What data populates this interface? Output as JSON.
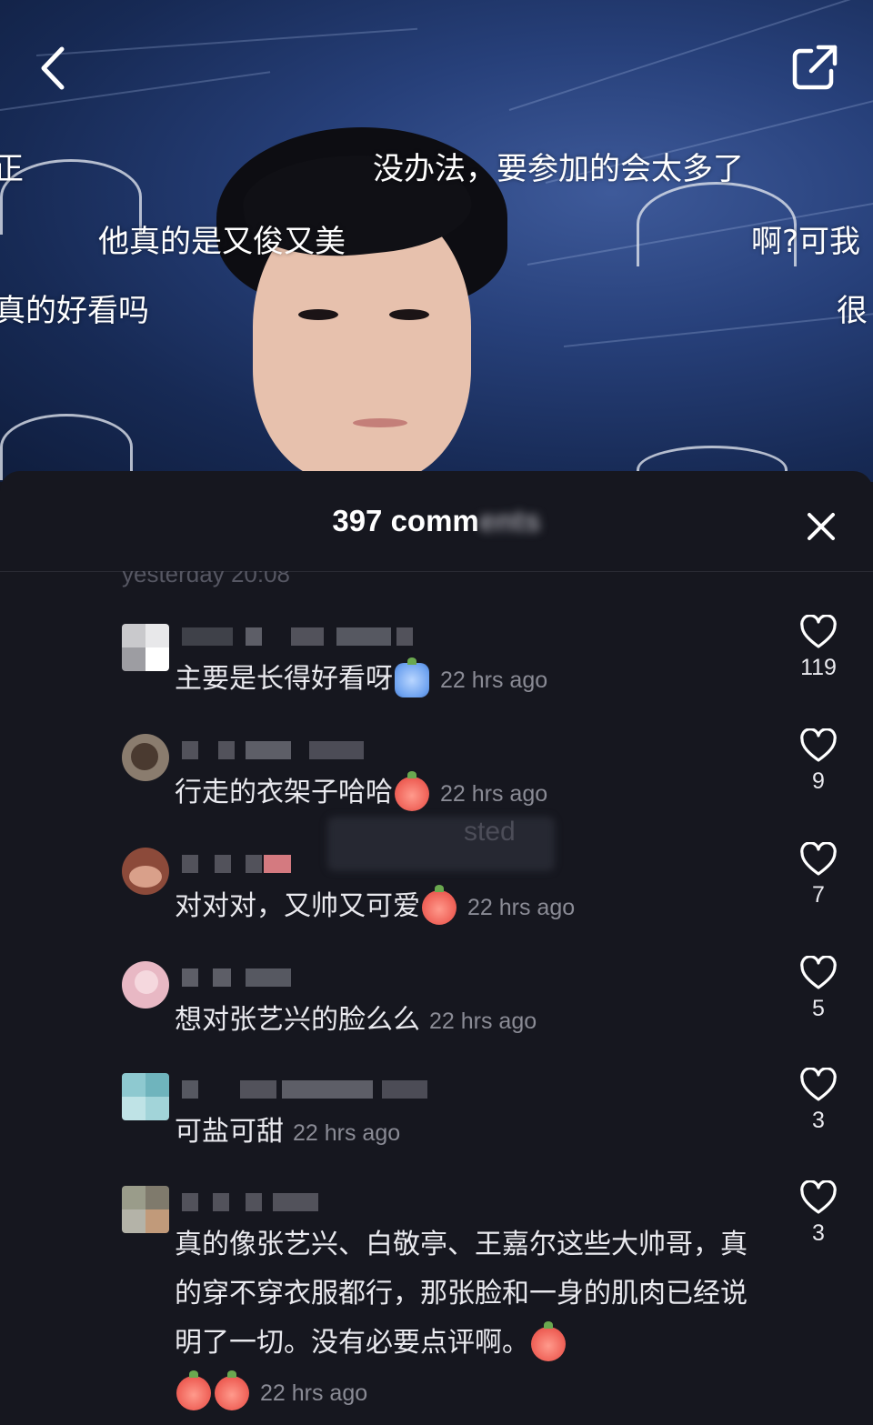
{
  "video": {
    "danmaku": [
      "没办法，要参加的会太多了",
      "他真的是又俊又美",
      "真的好看吗",
      "啊?可我",
      "很",
      "正"
    ]
  },
  "sheet": {
    "title": "397 comm",
    "title_obscured": "ents",
    "peek_text": "yesterday 20:08"
  },
  "comments": [
    {
      "text": "主要是长得好看呀",
      "emojis": [
        "crying-blue"
      ],
      "time": "22 hrs ago",
      "likes": "119"
    },
    {
      "text": "行走的衣架子哈哈",
      "emojis": [
        "laugh"
      ],
      "time": "22 hrs ago",
      "likes": "9"
    },
    {
      "text": "对对对，又帅又可爱",
      "emojis": [
        "shy"
      ],
      "time": "22 hrs ago",
      "likes": "7",
      "overlay": "sted"
    },
    {
      "text": "想对张艺兴的脸么么",
      "emojis": [],
      "time": "22 hrs ago",
      "likes": "5"
    },
    {
      "text": "可盐可甜",
      "emojis": [],
      "time": "22 hrs ago",
      "likes": "3"
    },
    {
      "text": "真的像张艺兴、白敬亭、王嘉尔这些大帅哥，真的穿不穿衣服都行，那张脸和一身的肌肉已经说明了一切。没有必要点评啊。",
      "emojis": [
        "cry",
        "cry",
        "cry"
      ],
      "time": "22 hrs ago",
      "likes": "3"
    }
  ],
  "colors": {
    "sheet_bg": "#16171f",
    "text": "#e9e9ee",
    "muted": "#8a8b95"
  },
  "icons": [
    "back-arrow-icon",
    "share-icon",
    "close-icon",
    "heart-icon"
  ]
}
